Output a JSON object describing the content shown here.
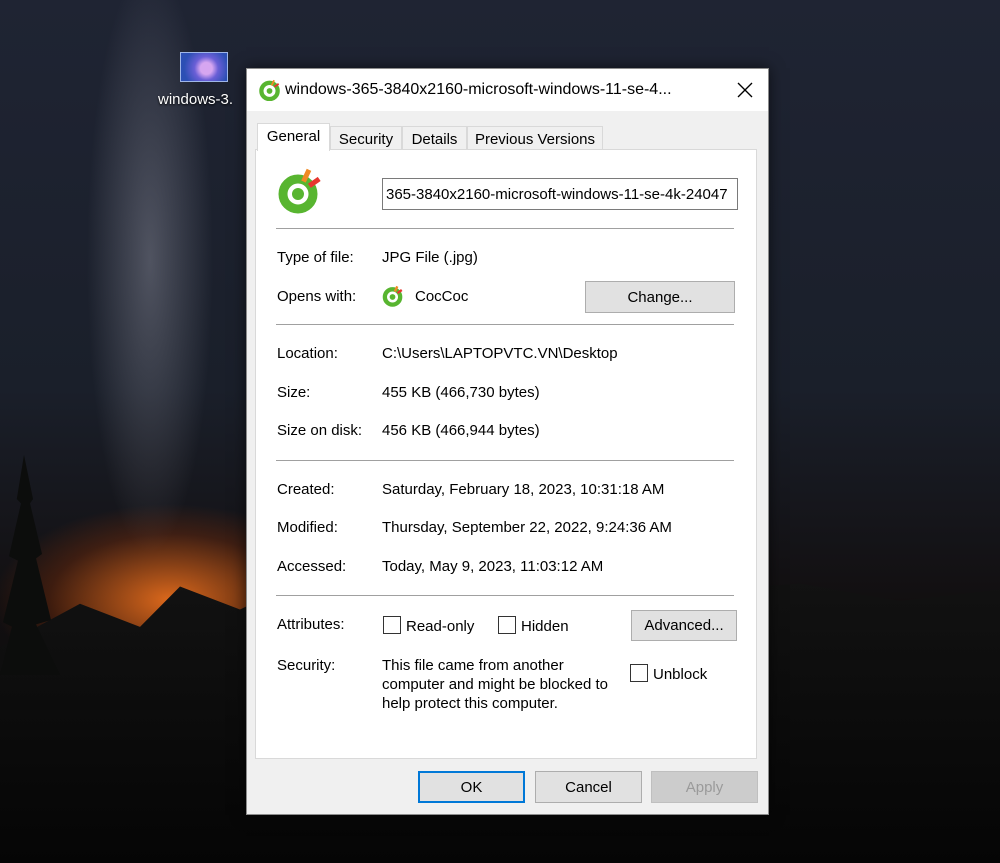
{
  "desktop": {
    "icon_label": "windows-3."
  },
  "dialog": {
    "title": "windows-365-3840x2160-microsoft-windows-11-se-4...",
    "tabs": [
      {
        "label": "General"
      },
      {
        "label": "Security"
      },
      {
        "label": "Details"
      },
      {
        "label": "Previous Versions"
      }
    ],
    "filename_value": "365-3840x2160-microsoft-windows-11-se-4k-24047",
    "type_label": "Type of file:",
    "type_value": "JPG File (.jpg)",
    "opens_label": "Opens with:",
    "opens_value": "CocCoc",
    "change_button": "Change...",
    "location_label": "Location:",
    "location_value": "C:\\Users\\LAPTOPVTC.VN\\Desktop",
    "size_label": "Size:",
    "size_value": "455 KB (466,730 bytes)",
    "size_disk_label": "Size on disk:",
    "size_disk_value": "456 KB (466,944 bytes)",
    "created_label": "Created:",
    "created_value": "Saturday, February 18, 2023, 10:31:18 AM",
    "modified_label": "Modified:",
    "modified_value": "Thursday, September 22, 2022, 9:24:36 AM",
    "accessed_label": "Accessed:",
    "accessed_value": "Today, May 9, 2023, 11:03:12 AM",
    "attributes_label": "Attributes:",
    "readonly_label": "Read-only",
    "readonly_checked": false,
    "hidden_label": "Hidden",
    "hidden_checked": false,
    "advanced_button": "Advanced...",
    "security_label": "Security:",
    "security_text": "This file came from another computer and might be blocked to help protect this computer.",
    "unblock_label": "Unblock",
    "unblock_checked": false,
    "ok_button": "OK",
    "cancel_button": "Cancel",
    "apply_button": "Apply",
    "accent_color": "#0078d7"
  }
}
